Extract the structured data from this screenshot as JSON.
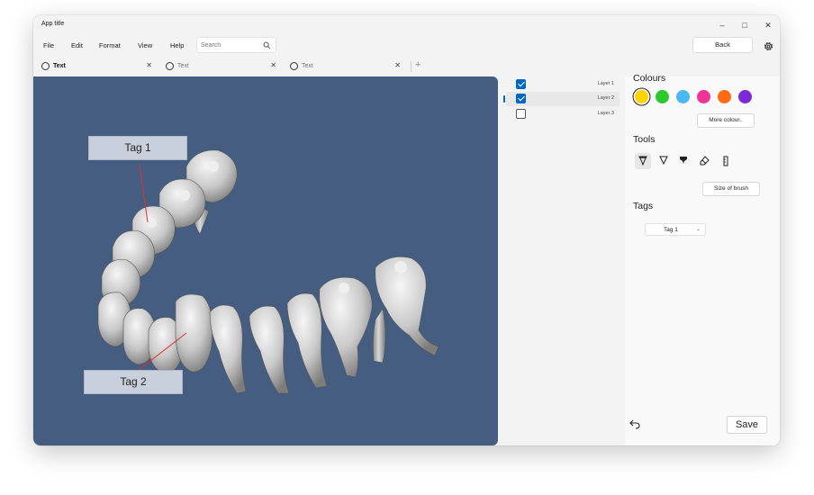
{
  "window": {
    "title": "App title",
    "controls": {
      "minimize": "–",
      "maximize": "□",
      "close": "✕"
    }
  },
  "menu": {
    "items": [
      "File",
      "Edit",
      "Format",
      "View",
      "Help"
    ],
    "search_placeholder": "Search",
    "back_label": "Back"
  },
  "tabs": [
    {
      "label": "Text",
      "active": true
    },
    {
      "label": "Text",
      "active": false
    },
    {
      "label": "Text",
      "active": false
    }
  ],
  "canvas": {
    "background": "#445d80",
    "tags": [
      {
        "label": "Tag 1"
      },
      {
        "label": "Tag 2"
      }
    ],
    "leader_color": "#e03030"
  },
  "layers": [
    {
      "label": "Layer 1",
      "checked": true,
      "selected": false
    },
    {
      "label": "Layer 2",
      "checked": true,
      "selected": true
    },
    {
      "label": "Layer 3",
      "checked": false,
      "selected": false
    }
  ],
  "properties": {
    "colours_title": "Colours",
    "colours": [
      "#ffd400",
      "#2dc82d",
      "#4cb8f0",
      "#ee3399",
      "#ff6a12",
      "#7c2ad6"
    ],
    "selected_colour_index": 0,
    "more_colours_label": "More colour..",
    "tools_title": "Tools",
    "tools": [
      "pen-tool",
      "highlighter-tool",
      "marker-tool",
      "eraser-tool",
      "ruler-tool"
    ],
    "selected_tool_index": 0,
    "brush_size_label": "Size of brush",
    "tags_title": "Tags",
    "tag_selected": "Tag 1",
    "save_label": "Save"
  }
}
